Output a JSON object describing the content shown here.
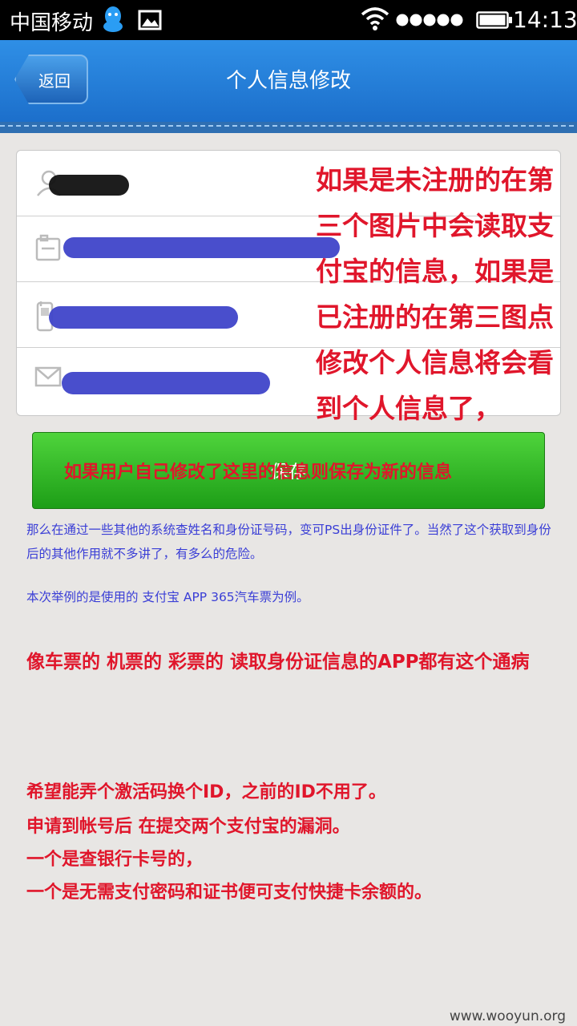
{
  "status_bar": {
    "carrier": "中国移动",
    "time": "14:13",
    "icons": [
      "qq-icon",
      "image-icon",
      "wifi-icon",
      "signal-icon",
      "battery-icon"
    ]
  },
  "header": {
    "back_label": "返回",
    "title": "个人信息修改"
  },
  "form": {
    "rows": [
      {
        "icon": "person-icon"
      },
      {
        "icon": "id-card-icon"
      },
      {
        "icon": "phone-icon"
      },
      {
        "icon": "mail-icon"
      }
    ]
  },
  "annotation": {
    "lines": [
      "如果是未注册的在第",
      "三个图片中会读取支",
      "付宝的信息，如果是",
      "已注册的在第三图点",
      "修改个人信息将会看",
      "到个人信息了，"
    ]
  },
  "save_button": {
    "label": "保存",
    "overlay_text": "如果用户自己修改了这里的信息则保存为新的信息"
  },
  "notes": {
    "p1": "那么在通过一些其他的系统查姓名和身份证号码，变可PS出身份证件了。当然了这个获取到身份后的其他作用就不多讲了，有多么的危险。",
    "p2": "本次举例的是使用的 支付宝 APP 365汽车票为例。",
    "p3": "像车票的 机票的 彩票的 读取身份证信息的APP都有这个通病",
    "p4": [
      "希望能弄个激活码换个ID，之前的ID不用了。",
      "申请到帐号后 在提交两个支付宝的漏洞。",
      "一个是查银行卡号的，",
      "一个是无需支付密码和证书便可支付快捷卡余额的。"
    ]
  },
  "watermark": "www.wooyun.org",
  "colors": {
    "header_blue": "#1c6fcb",
    "annotation_red": "#e0162b",
    "note_blue": "#3a3ed6",
    "button_green": "#1d9e17"
  }
}
